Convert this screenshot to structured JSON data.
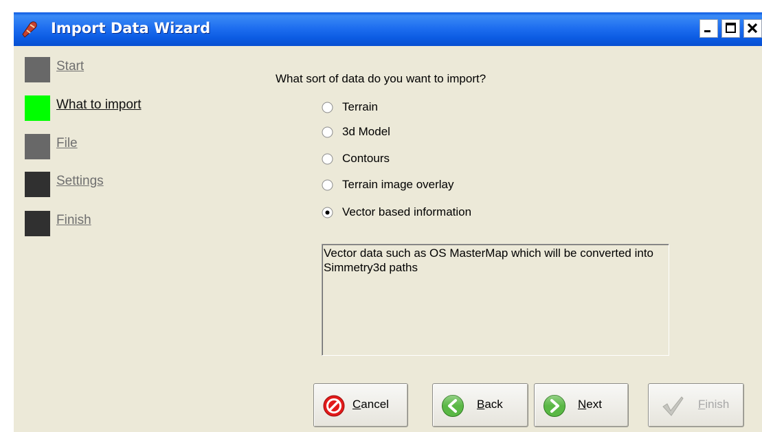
{
  "window": {
    "title": "Import Data Wizard"
  },
  "steps": [
    {
      "label": "Start",
      "state": "done",
      "color": "#686868"
    },
    {
      "label": "What to import",
      "state": "current",
      "color": "#00ff00"
    },
    {
      "label": "File",
      "state": "pending",
      "color": "#686868"
    },
    {
      "label": "Settings",
      "state": "pending",
      "color": "#303030"
    },
    {
      "label": "Finish",
      "state": "pending",
      "color": "#303030"
    }
  ],
  "question": "What sort of data do you want to import?",
  "options": [
    {
      "label": "Terrain",
      "selected": false
    },
    {
      "label": "3d Model",
      "selected": false
    },
    {
      "label": "Contours",
      "selected": false
    },
    {
      "label": "Terrain image overlay",
      "selected": false
    },
    {
      "label": "Vector based information",
      "selected": true
    }
  ],
  "description": "Vector data such as OS MasterMap which will be converted into Simmetry3d paths",
  "buttons": {
    "cancel": {
      "accel": "C",
      "rest": "ancel",
      "icon": "cancel-icon"
    },
    "back": {
      "accel": "B",
      "rest": "ack",
      "icon": "back-arrow-icon"
    },
    "next": {
      "accel": "N",
      "rest": "ext",
      "icon": "next-arrow-icon"
    },
    "finish": {
      "accel": "F",
      "rest": "inish",
      "icon": "checkmark-icon",
      "enabled": false
    }
  },
  "colors": {
    "titlebar": "#0c5ce3",
    "current_step": "#00ff00",
    "window_bg": "#ece9d8"
  }
}
